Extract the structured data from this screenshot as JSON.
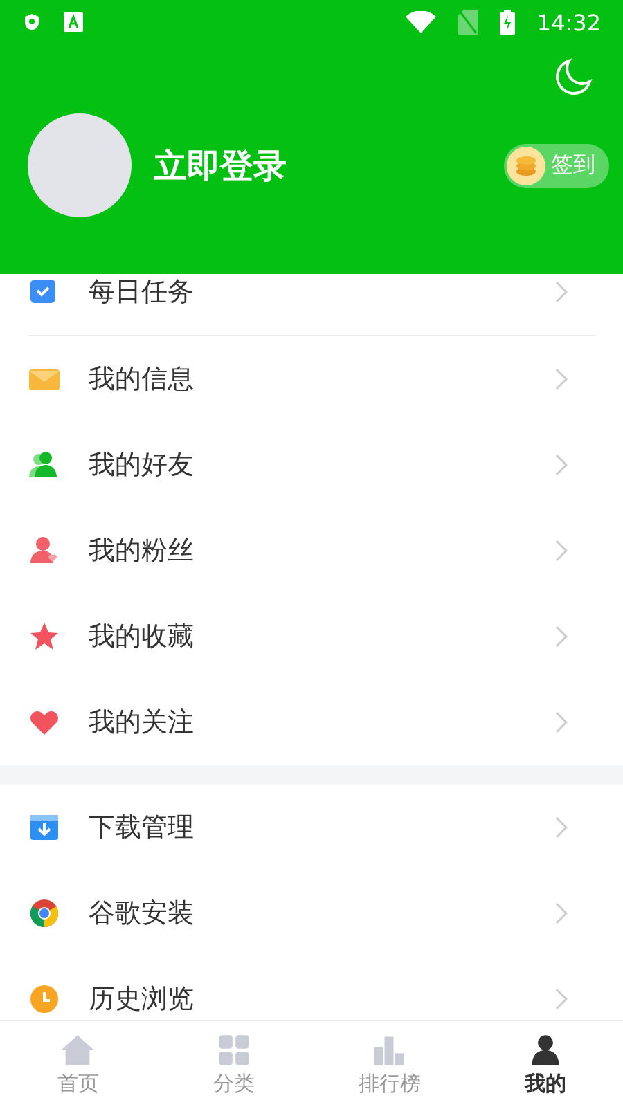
{
  "status_bar": {
    "time": "14:32"
  },
  "header": {
    "login_label": "立即登录",
    "checkin_label": "签到"
  },
  "sections": [
    {
      "items": [
        "每日任务",
        "我的信息",
        "我的好友",
        "我的粉丝",
        "我的收藏",
        "我的关注"
      ]
    },
    {
      "items": [
        "下载管理",
        "谷歌安装",
        "历史浏览"
      ]
    }
  ],
  "bottom_nav": [
    {
      "label": "首页",
      "selected": false
    },
    {
      "label": "分类",
      "selected": false
    },
    {
      "label": "排行榜",
      "selected": false
    },
    {
      "label": "我的",
      "selected": true
    }
  ]
}
